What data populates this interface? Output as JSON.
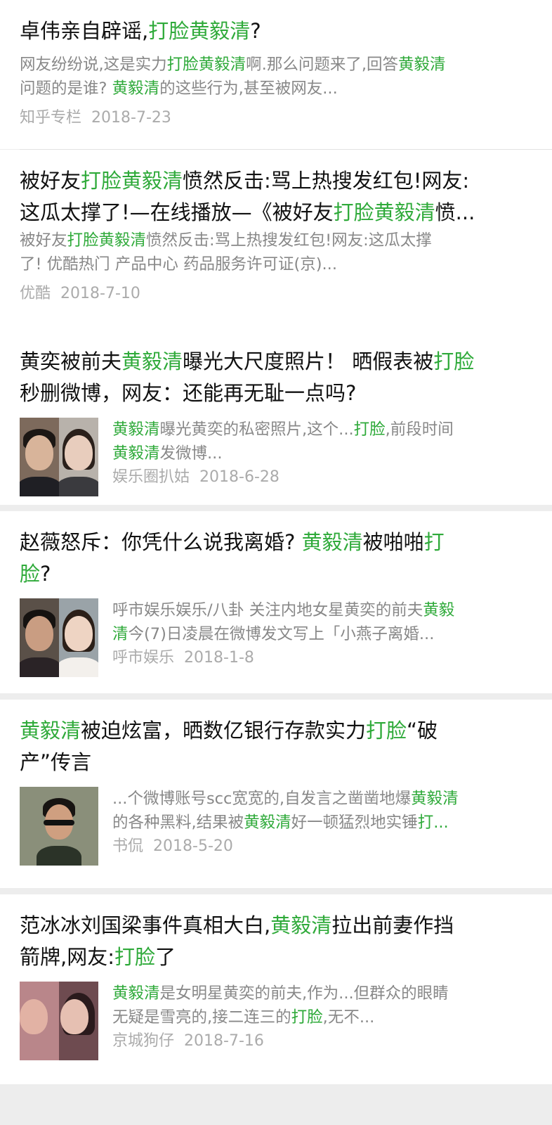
{
  "results": [
    {
      "title": [
        {
          "t": "卓伟亲自辟谣,"
        },
        {
          "t": "打脸黄毅清",
          "hl": true
        },
        {
          "t": "?"
        }
      ],
      "snippet": [
        {
          "t": "网友纷纷说,这是实力"
        },
        {
          "t": "打脸黄毅清",
          "hl": true
        },
        {
          "t": "啊.那么问题来了,回答"
        },
        {
          "t": "黄毅清",
          "hl": true
        }
      ],
      "snippet2": [
        {
          "t": "问题的是谁? "
        },
        {
          "t": "黄毅清",
          "hl": true
        },
        {
          "t": "的这些行为,甚至被网友..."
        }
      ],
      "source": "知乎专栏",
      "date": "2018-7-23"
    },
    {
      "title": [
        {
          "t": "被好友"
        },
        {
          "t": "打脸黄毅清",
          "hl": true
        },
        {
          "t": "愤然反击:骂上热搜发红包!网友:"
        }
      ],
      "title2": [
        {
          "t": "这瓜太撑了!—在线播放—《被好友"
        },
        {
          "t": "打脸黄毅清",
          "hl": true
        },
        {
          "t": "愤..."
        }
      ],
      "snippet": [
        {
          "t": "被好友"
        },
        {
          "t": "打脸黄毅清",
          "hl": true
        },
        {
          "t": "愤然反击:骂上热搜发红包!网友:这瓜太撑"
        }
      ],
      "snippet2": [
        {
          "t": "了! 优酷热门 产品中心 药品服务许可证(京)..."
        }
      ],
      "source": "优酷",
      "date": "2018-7-10"
    },
    {
      "title": [
        {
          "t": "黄奕被前夫"
        },
        {
          "t": "黄毅清",
          "hl": true
        },
        {
          "t": "曝光大尺度照片！ 晒假表被"
        },
        {
          "t": "打脸",
          "hl": true
        }
      ],
      "title2": [
        {
          "t": "秒删微博，网友：还能再无耻一点吗?"
        }
      ],
      "snippet": [
        {
          "t": "黄毅清",
          "hl": true
        },
        {
          "t": "曝光黄奕的私密照片,这个..."
        },
        {
          "t": "打脸",
          "hl": true
        },
        {
          "t": ",前段时间"
        }
      ],
      "snippet2": [
        {
          "t": "黄毅清",
          "hl": true
        },
        {
          "t": "发微博..."
        }
      ],
      "source": "娱乐圈扒姑",
      "date": "2018-6-28",
      "thumb": "thumb-man-and-woman"
    },
    {
      "title": [
        {
          "t": "赵薇怒斥：你凭什么说我离婚? "
        },
        {
          "t": "黄毅清",
          "hl": true
        },
        {
          "t": "被啪啪"
        },
        {
          "t": "打",
          "hl": true
        }
      ],
      "title2": [
        {
          "t": "脸",
          "hl": true
        },
        {
          "t": "?"
        }
      ],
      "snippet": [
        {
          "t": "呼市娱乐娱乐/八卦 关注内地女星黄奕的前夫"
        },
        {
          "t": "黄毅",
          "hl": true
        }
      ],
      "snippet2": [
        {
          "t": "清",
          "hl": true
        },
        {
          "t": "今(7)日凌晨在微博发文写上「小燕子离婚..."
        }
      ],
      "source": "呼市娱乐",
      "date": "2018-1-8",
      "thumb": "thumb-couple"
    },
    {
      "title": [
        {
          "t": "黄毅清",
          "hl": true
        },
        {
          "t": "被迫炫富，晒数亿银行存款实力"
        },
        {
          "t": "打脸",
          "hl": true
        },
        {
          "t": "“破"
        }
      ],
      "title2": [
        {
          "t": "产”传言"
        }
      ],
      "snippet": [
        {
          "t": "...个微博账号scc宽宽的,自发言之凿凿地爆"
        },
        {
          "t": "黄毅清",
          "hl": true
        }
      ],
      "snippet2": [
        {
          "t": "的各种黑料,结果被"
        },
        {
          "t": "黄毅清",
          "hl": true
        },
        {
          "t": "好一顿猛烈地实锤"
        },
        {
          "t": "打...",
          "hl": true
        }
      ],
      "source": "书侃",
      "date": "2018-5-20",
      "thumb": "thumb-man-sunglasses"
    },
    {
      "title": [
        {
          "t": "范冰冰刘国梁事件真相大白,"
        },
        {
          "t": "黄毅清",
          "hl": true
        },
        {
          "t": "拉出前妻作挡"
        }
      ],
      "title2": [
        {
          "t": "箭牌,网友:"
        },
        {
          "t": "打脸",
          "hl": true
        },
        {
          "t": "了"
        }
      ],
      "snippet": [
        {
          "t": "黄毅清",
          "hl": true
        },
        {
          "t": "是女明星黄奕的前夫,作为...但群众的眼睛"
        }
      ],
      "snippet2": [
        {
          "t": "无疑是雪亮的,接二连三的"
        },
        {
          "t": "打脸",
          "hl": true
        },
        {
          "t": ",无不..."
        }
      ],
      "source": "京城狗仔",
      "date": "2018-7-16",
      "thumb": "thumb-kiss"
    }
  ],
  "colors": {
    "highlight": "#2faa3a",
    "title": "#111111",
    "snippet": "#888888",
    "meta": "#ababab",
    "separator": "#ededed"
  }
}
